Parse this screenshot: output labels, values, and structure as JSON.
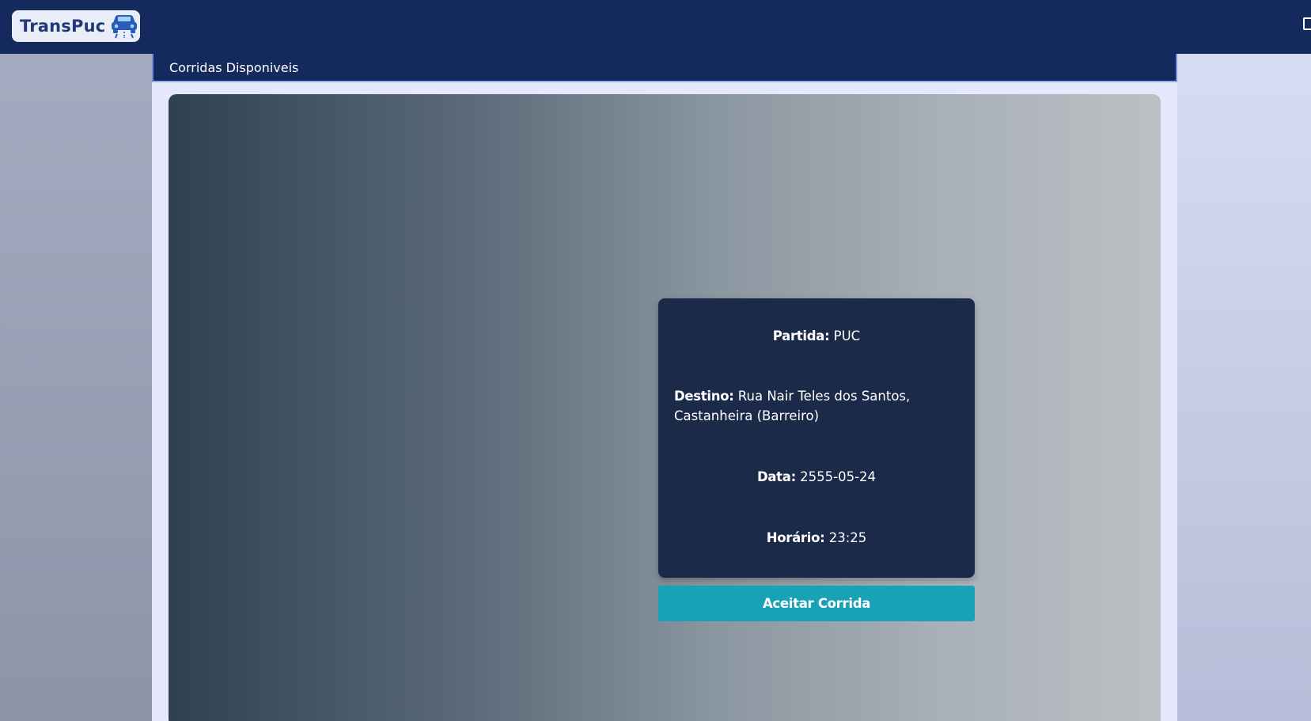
{
  "app": {
    "logo_text": "TransPuc",
    "logo_icon": "car-icon"
  },
  "topbar": {
    "logout_icon": "logout-icon",
    "background": "#152a5c"
  },
  "subheader": {
    "title": "Corridas Disponiveis"
  },
  "ride": {
    "partida_label": "Partida:",
    "partida_value": "PUC",
    "destino_label": "Destino:",
    "destino_value": "Rua Nair Teles dos Santos, Castanheira (Barreiro)",
    "data_label": "Data:",
    "data_value": "2555-05-24",
    "horario_label": "Horário:",
    "horario_value": "23:25"
  },
  "actions": {
    "accept_label": "Aceitar Corrida",
    "accent": "#17a2b8"
  }
}
